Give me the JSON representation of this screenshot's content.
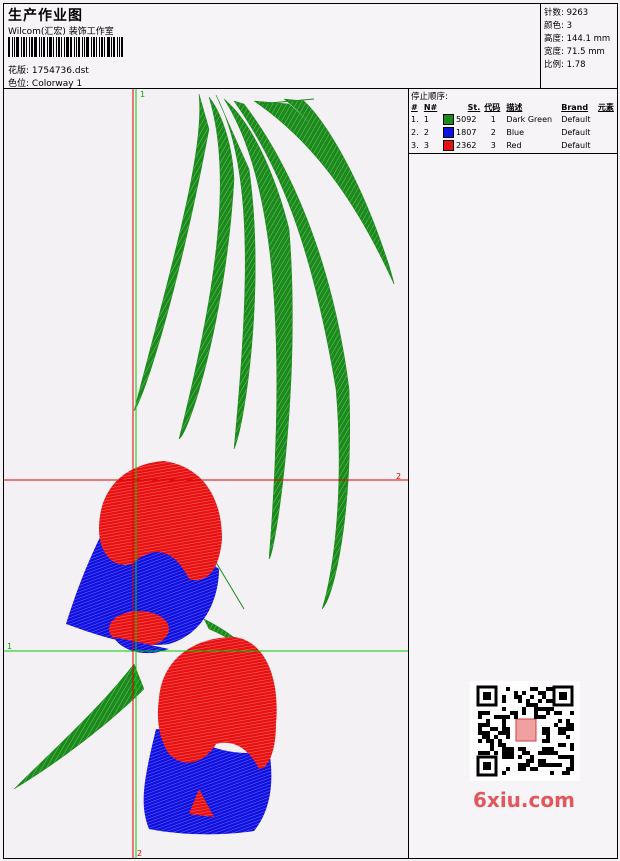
{
  "header": {
    "title": "生产作业图",
    "company": "Wilcom(汇宏) 装饰工作室",
    "design_label": "花版:",
    "design_value": "1754736.dst",
    "colorway_label": "色位:",
    "colorway_value": "Colorway 1"
  },
  "stats": {
    "stitches_label": "针数:",
    "stitches_value": "9263",
    "colors_label": "颜色:",
    "colors_value": "3",
    "height_label": "高度:",
    "height_value": "144.1 mm",
    "width_label": "宽度:",
    "width_value": "71.5 mm",
    "ratio_label": "比例:",
    "ratio_value": "1.78"
  },
  "stop_sequence": {
    "title": "停止顺序:",
    "columns": [
      "#",
      "N#",
      "St.",
      "代码",
      "描述",
      "Brand",
      "元素"
    ],
    "rows": [
      {
        "index": "1.",
        "n": "1",
        "color": "#1a8a1a",
        "stitches": "5092",
        "code": "1",
        "desc": "Dark Green",
        "brand": "Default"
      },
      {
        "index": "2.",
        "n": "2",
        "color": "#1010e0",
        "stitches": "1807",
        "code": "2",
        "desc": "Blue",
        "brand": "Default"
      },
      {
        "index": "3.",
        "n": "3",
        "color": "#e81010",
        "stitches": "2362",
        "code": "3",
        "desc": "Red",
        "brand": "Default"
      }
    ]
  },
  "canvas": {
    "guide_labels": {
      "top": "1",
      "right": "2",
      "left": "1",
      "bottom": "2"
    },
    "guide_colors": {
      "green": "#00cc00",
      "red": "#e00000"
    },
    "thread_colors": {
      "green": "#1a8a1a",
      "blue": "#1010e0",
      "red": "#e81010"
    }
  },
  "watermark": {
    "text": "6xiu.com",
    "color": "#e2575c"
  }
}
